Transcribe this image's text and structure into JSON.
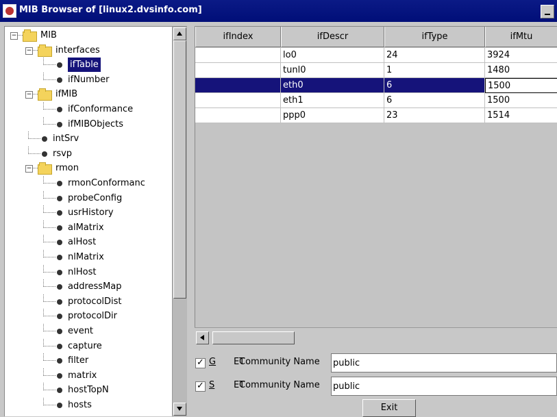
{
  "window": {
    "title": "MIB Browser of [linux2.dvsinfo.com]",
    "icon": "mib-browser-icon",
    "button": "minimize-icon"
  },
  "tree": {
    "items": [
      {
        "label": "MIB",
        "type": "folder",
        "expanded": "−"
      },
      {
        "label": "interfaces",
        "type": "folder",
        "expanded": "−"
      },
      {
        "label": "ifTable",
        "type": "leaf",
        "selected": "true"
      },
      {
        "label": "ifNumber",
        "type": "leaf"
      },
      {
        "label": "ifMIB",
        "type": "folder",
        "expanded": "−"
      },
      {
        "label": "ifConformance",
        "type": "leaf"
      },
      {
        "label": "ifMIBObjects",
        "type": "leaf"
      },
      {
        "label": "intSrv",
        "type": "leaf"
      },
      {
        "label": "rsvp",
        "type": "leaf"
      },
      {
        "label": "rmon",
        "type": "folder",
        "expanded": "−"
      },
      {
        "label": "rmonConformanc",
        "type": "leaf"
      },
      {
        "label": "probeConfig",
        "type": "leaf"
      },
      {
        "label": "usrHistory",
        "type": "leaf"
      },
      {
        "label": "alMatrix",
        "type": "leaf"
      },
      {
        "label": "alHost",
        "type": "leaf"
      },
      {
        "label": "nlMatrix",
        "type": "leaf"
      },
      {
        "label": "nlHost",
        "type": "leaf"
      },
      {
        "label": "addressMap",
        "type": "leaf"
      },
      {
        "label": "protocolDist",
        "type": "leaf"
      },
      {
        "label": "protocolDir",
        "type": "leaf"
      },
      {
        "label": "event",
        "type": "leaf"
      },
      {
        "label": "capture",
        "type": "leaf"
      },
      {
        "label": "filter",
        "type": "leaf"
      },
      {
        "label": "matrix",
        "type": "leaf"
      },
      {
        "label": "hostTopN",
        "type": "leaf"
      },
      {
        "label": "hosts",
        "type": "leaf"
      }
    ]
  },
  "table": {
    "columns": [
      "ifIndex",
      "ifDescr",
      "ifType",
      "ifMtu"
    ],
    "rows": [
      [
        "",
        "lo0",
        "24",
        "3924"
      ],
      [
        "",
        "tunl0",
        "1",
        "1480"
      ],
      [
        "",
        "eth0",
        "6",
        "1500"
      ],
      [
        "",
        "eth1",
        "6",
        "1500"
      ],
      [
        "",
        "ppp0",
        "23",
        "1514"
      ]
    ],
    "selected_row_index": 2,
    "selected_editing_column": "ifMtu"
  },
  "form": {
    "get": {
      "checked": "✓",
      "method_prefix": "G",
      "method_rest": "ET",
      "label": "Community Name",
      "value": "public"
    },
    "set": {
      "checked": "✓",
      "method_prefix": "S",
      "method_rest": "ET",
      "label": "Community Name",
      "value": "public"
    },
    "exit_label": "Exit"
  }
}
